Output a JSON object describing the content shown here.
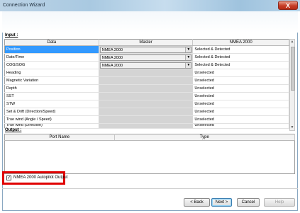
{
  "window": {
    "title": "Connection Wizard",
    "close_label": "X"
  },
  "input": {
    "section_label": "Input :",
    "columns": [
      "Data",
      "Master",
      "NMEA 2000"
    ],
    "rows": [
      {
        "data": "Position",
        "master": "NMEA 2000",
        "status": "Selected & Detected"
      },
      {
        "data": "Date/Time",
        "master": "NMEA 2000",
        "status": "Selected & Detected"
      },
      {
        "data": "COG/SOG",
        "master": "NMEA 2000",
        "status": "Selected & Detected"
      },
      {
        "data": "Heading",
        "master": "",
        "status": "Unselected"
      },
      {
        "data": "Magnetic Variation",
        "master": "",
        "status": "Unselected"
      },
      {
        "data": "Depth",
        "master": "",
        "status": "Unselected"
      },
      {
        "data": "SST",
        "master": "",
        "status": "Unselected"
      },
      {
        "data": "STW",
        "master": "",
        "status": "Unselected"
      },
      {
        "data": "Set & Drift (Direction/Speed)",
        "master": "",
        "status": "Unselected"
      },
      {
        "data": "True wind (Angle / Speed)",
        "master": "",
        "status": "Unselected"
      },
      {
        "data": "True wind (Direction)",
        "master": "",
        "status": "Unselected"
      }
    ]
  },
  "output": {
    "section_label": "Output :",
    "columns": [
      "Port Name",
      "Type"
    ]
  },
  "autopilot": {
    "label": "NMEA 2000 Autopilot Output",
    "checked": true,
    "checkmark": "✓"
  },
  "buttons": {
    "back": "< Back",
    "next": "Next >",
    "cancel": "Cancel",
    "help": "Help"
  },
  "colors": {
    "selection": "#3399ff",
    "highlight_border": "#e00000"
  }
}
